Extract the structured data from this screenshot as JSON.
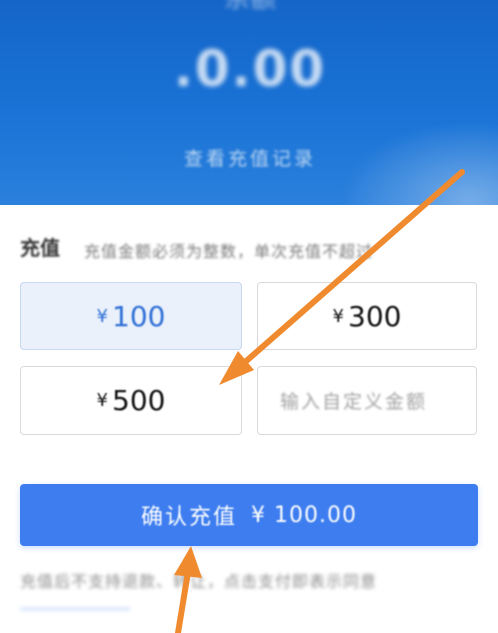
{
  "header": {
    "balance_label": "余额",
    "balance_value": ".0.00",
    "history_link": "查看充值记录"
  },
  "recharge": {
    "title": "充值",
    "hint": "充值金额必须为整数，单次充值不超过",
    "currency_symbol": "¥",
    "options": [
      {
        "amount": "100",
        "selected": true
      },
      {
        "amount": "300",
        "selected": false
      },
      {
        "amount": "500",
        "selected": false
      }
    ],
    "custom_placeholder": "输入自定义金额"
  },
  "confirm": {
    "label": "确认充值",
    "amount": "¥ 100.00"
  },
  "footer": {
    "note": "充值后不支持退款、转让，点击支付即表示同意"
  },
  "colors": {
    "header_blue": "#1a73d6",
    "accent_blue": "#3d7df0",
    "selected_text": "#2f6fd6",
    "annotation_orange": "#f08a2e"
  },
  "annotations": [
    "arrow-to-500-card",
    "arrow-to-confirm-button"
  ]
}
